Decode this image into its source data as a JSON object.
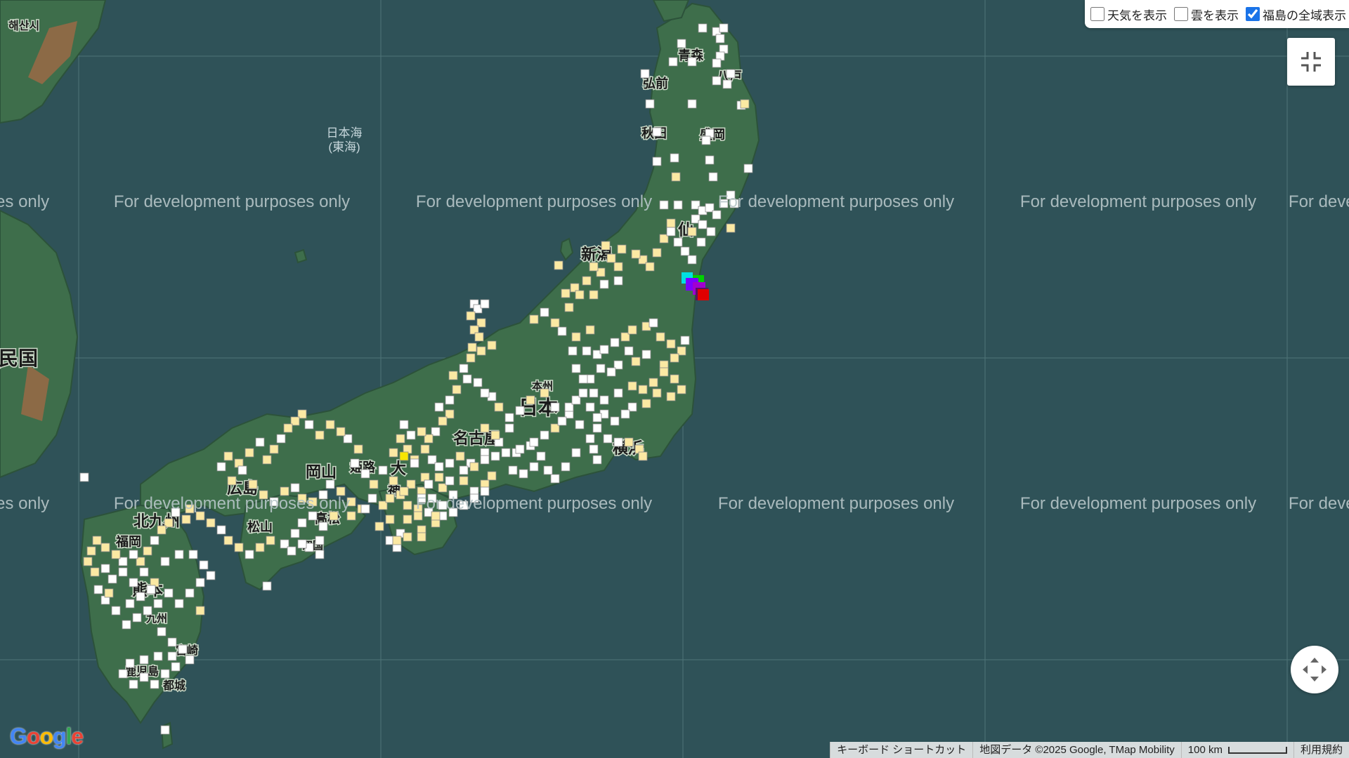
{
  "controls": {
    "weather_label": "天気を表示",
    "weather_checked": false,
    "cloud_label": "雲を表示",
    "cloud_checked": false,
    "fukushima_label": "福島の全域表示",
    "fukushima_checked": true
  },
  "watermark": "For development purposes only",
  "places": {
    "haesansi": "해산시",
    "korea": "民国",
    "sea_of_japan_1": "日本海",
    "sea_of_japan_2": "(東海)",
    "aomori": "青森",
    "hirosaki": "弘前",
    "hachinohe": "八戸",
    "akita": "秋田",
    "morioka": "盛岡",
    "sendai": "仙",
    "niigata": "新潟",
    "japan": "日本",
    "honshu": "本州",
    "nagoya": "名古屋",
    "yokohama": "横浜",
    "okayama": "岡山",
    "himeji": "姫路",
    "osaka": "大",
    "kobe": "神",
    "hiroshima": "広島",
    "kitakyushu": "北九州",
    "fukuoka": "福岡",
    "matsuyama": "松山",
    "takamatsu": "高松",
    "shikoku": "四国",
    "kumamoto": "熊本",
    "kyushu": "九州",
    "miyazaki": "宮崎",
    "kagoshima": "鹿児島",
    "miyakonojo": "都城"
  },
  "attribution": {
    "keyboard": "キーボード ショートカット",
    "map_data": "地図データ ©2025 Google, TMap Mobility",
    "scale": "100 km",
    "terms": "利用規約"
  },
  "logo": "Google",
  "colors": {
    "sea": "#2f5258",
    "land": "#3e6e4b",
    "marker_white": "#ffffff",
    "marker_pale_yellow": "#fbe9a3",
    "marker_yellow": "#f7e500",
    "fukushima_red": "#e00000",
    "fukushima_purple": "#7a00ff",
    "fukushima_green": "#00d000",
    "fukushima_cyan": "#00e0e0"
  },
  "icons": {
    "fullscreen": "fullscreen-exit-icon",
    "pan": "pan-arrows-icon"
  }
}
